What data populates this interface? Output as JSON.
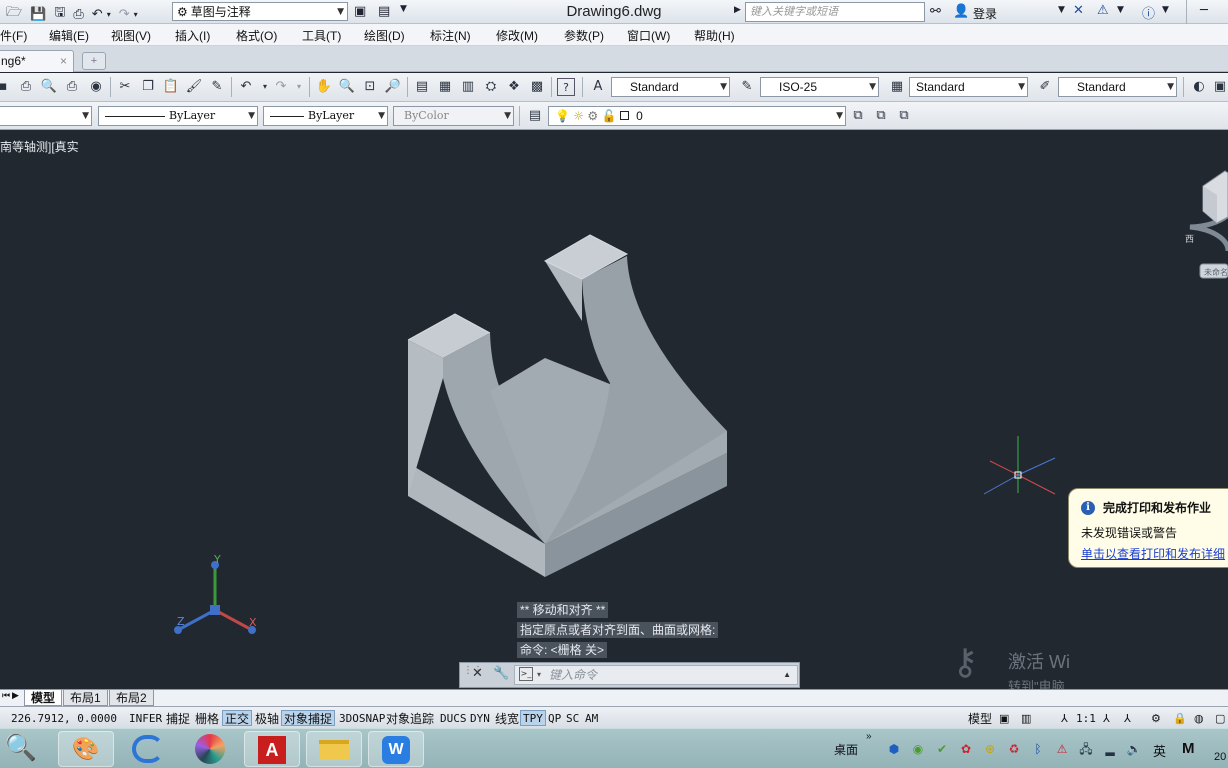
{
  "titlebar": {
    "workspace": "草图与注释",
    "document_title": "Drawing6.dwg",
    "search_placeholder": "键入关键字或短语",
    "login_label": "登录",
    "icons": [
      "open-icon",
      "save-icon",
      "saveas-icon",
      "print-icon",
      "undo-icon",
      "redo-icon",
      "binoculars-icon",
      "user-icon",
      "exchange-icon",
      "autodesk-icon",
      "help-icon"
    ]
  },
  "menu": {
    "items": [
      "件(F)",
      "编辑(E)",
      "视图(V)",
      "插入(I)",
      "格式(O)",
      "工具(T)",
      "绘图(D)",
      "标注(N)",
      "修改(M)",
      "参数(P)",
      "窗口(W)",
      "帮助(H)"
    ]
  },
  "tabs": {
    "document": "ng6*",
    "close": "×"
  },
  "toolbar1": {
    "text_style": "Standard",
    "dim_style": "ISO-25",
    "table_style": "Standard",
    "multileader_style": "Standard"
  },
  "toolbar2": {
    "linetype": "ByLayer",
    "lineweight": "ByLayer",
    "plotstyle": "ByColor",
    "layer": "0"
  },
  "viewport": {
    "view_label": "南等轴测][真实",
    "axes": {
      "x": "X",
      "y": "Y",
      "z": "Z"
    },
    "compass_label": "西",
    "ucs_label": "未命名"
  },
  "command": {
    "history": [
      "** 移动和对齐 **",
      "指定原点或者对齐到面、曲面或网格:",
      "命令: <栅格 关>"
    ],
    "placeholder": "键入命令"
  },
  "watermark": {
    "line1": "激活 Wi",
    "line2": "转到\"电脑"
  },
  "notification": {
    "title": "完成打印和发布作业",
    "body": "未发现错误或警告",
    "link": "单击以查看打印和发布详细"
  },
  "layout_tabs": [
    "模型",
    "布局1",
    "布局2"
  ],
  "statusbar": {
    "coords": "226.7912, 0.0000",
    "toggles": [
      {
        "label": "INFER",
        "on": false
      },
      {
        "label": "捕捉",
        "on": false
      },
      {
        "label": "栅格",
        "on": false
      },
      {
        "label": "正交",
        "on": true
      },
      {
        "label": "极轴",
        "on": false
      },
      {
        "label": "对象捕捉",
        "on": true
      },
      {
        "label": "3DOSNAP",
        "on": false
      },
      {
        "label": "对象追踪",
        "on": false
      },
      {
        "label": "DUCS",
        "on": false
      },
      {
        "label": "DYN",
        "on": false
      },
      {
        "label": "线宽",
        "on": false
      },
      {
        "label": "TPY",
        "on": true
      },
      {
        "label": "QP",
        "on": false
      },
      {
        "label": "SC",
        "on": false
      },
      {
        "label": "AM",
        "on": false
      }
    ],
    "model_label": "模型",
    "scale": "1:1"
  },
  "taskbar": {
    "desktop_label": "桌面",
    "ime": "英",
    "ime_mode": "M",
    "clock_fragment": "20"
  }
}
